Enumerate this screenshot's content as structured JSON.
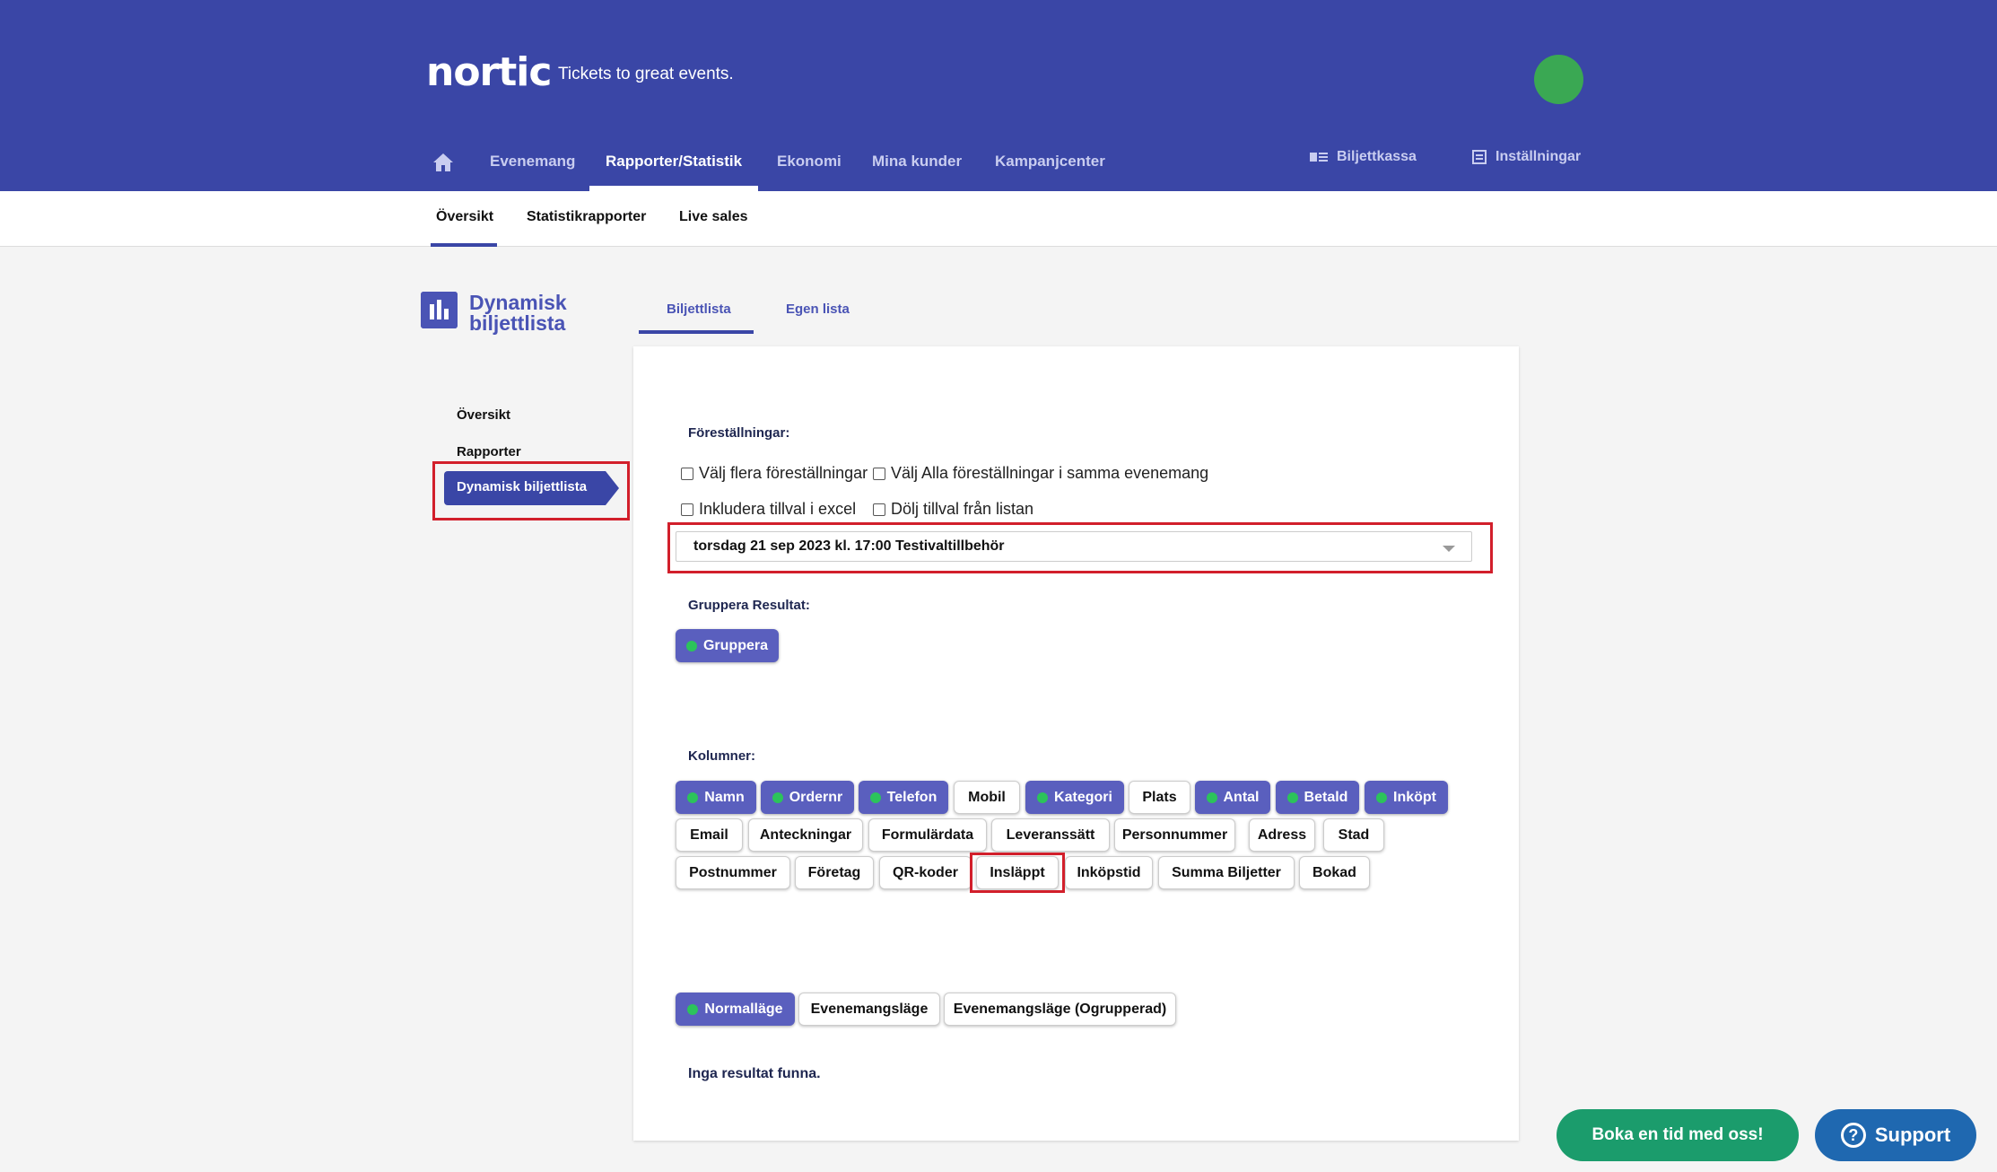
{
  "header": {
    "logo": "nortic",
    "tagline": "Tickets to great events.",
    "nav": [
      "Evenemang",
      "Rapporter/Statistik",
      "Ekonomi",
      "Mina kunder",
      "Kampanjcenter"
    ],
    "right_nav": {
      "box_office": "Biljettkassa",
      "settings": "Inställningar"
    }
  },
  "subnav": [
    "Översikt",
    "Statistikrapporter",
    "Live sales"
  ],
  "page": {
    "title_line1": "Dynamisk",
    "title_line2": "biljettlista"
  },
  "sidebar": {
    "items": [
      "Översikt",
      "Rapporter",
      "Dynamisk biljettlista"
    ]
  },
  "tabs": [
    "Biljettlista",
    "Egen lista"
  ],
  "form": {
    "performances_label": "Föreställningar:",
    "checkboxes": [
      "Välj flera föreställningar",
      "Välj Alla föreställningar i samma evenemang",
      "Inkludera tillval i excel",
      "Dölj tillval från listan"
    ],
    "selected_performance": "torsdag 21 sep 2023 kl. 17:00 Testivaltillbehör",
    "group_label": "Gruppera Resultat:",
    "group_button": "Gruppera",
    "columns_label": "Kolumner:",
    "columns": [
      "Namn",
      "Ordernr",
      "Telefon",
      "Mobil",
      "Kategori",
      "Plats",
      "Antal",
      "Betald",
      "Inköpt",
      "Email",
      "Anteckningar",
      "Formulärdata",
      "Leveranssätt",
      "Personnummer",
      "Adress",
      "Stad",
      "Postnummer",
      "Företag",
      "QR-koder",
      "Insläppt",
      "Inköpstid",
      "Summa Biljetter",
      "Bokad"
    ],
    "modes": [
      "Normalläge",
      "Evenemangsläge",
      "Evenemangsläge (Ogrupperad)"
    ],
    "no_results": "Inga resultat funna."
  },
  "footer_buttons": {
    "book": "Boka en tid med oss!",
    "support": "Support"
  },
  "colors": {
    "header_bg": "#3a46a6",
    "accent": "#5a5fbe",
    "highlight": "#d21f2b",
    "active_dot": "#2cc35b"
  }
}
